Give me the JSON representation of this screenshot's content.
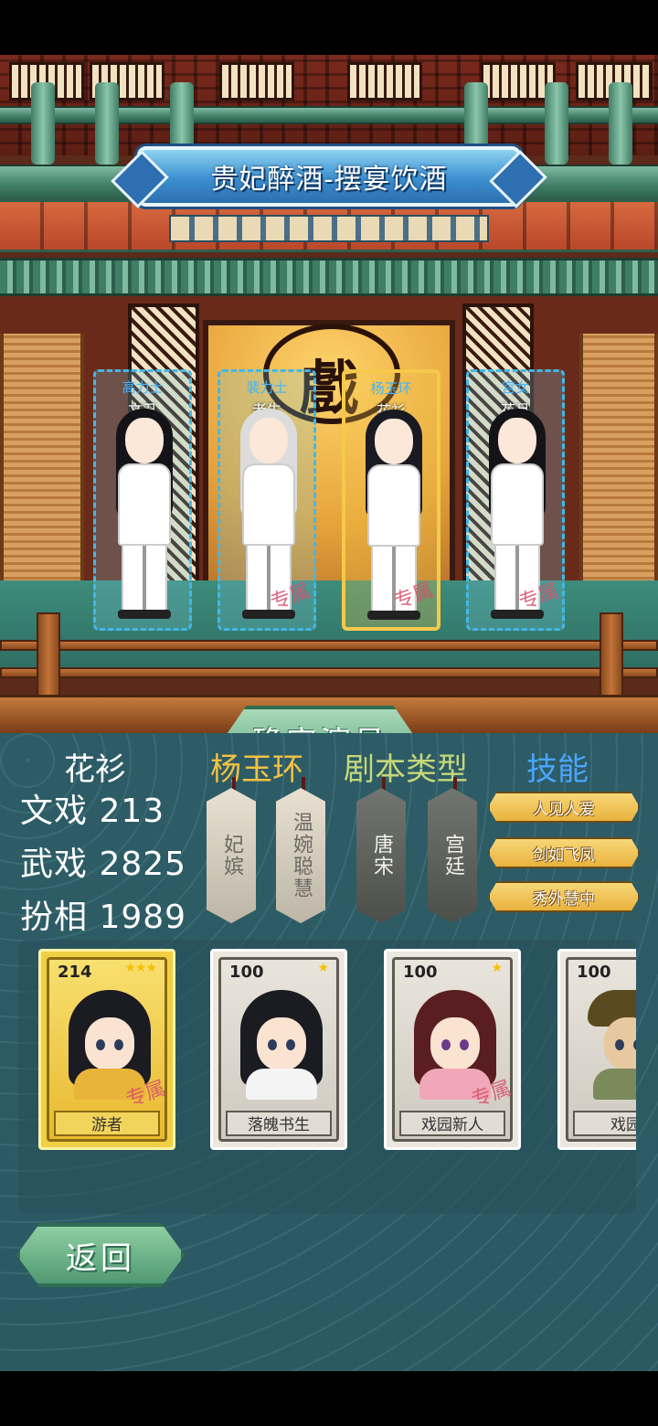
{
  "title": "贵妃醉酒-摆宴饮酒",
  "stage_sign": "戲",
  "exclusive_mark": "专属",
  "slots": [
    {
      "role": "高力士",
      "type": "文丑",
      "selected": false
    },
    {
      "role": "裴力士",
      "type": "老生",
      "selected": false
    },
    {
      "role": "杨玉环",
      "type": "花衫",
      "selected": true
    },
    {
      "role": "宫女",
      "type": "花旦",
      "selected": false
    }
  ],
  "confirm_label": "确定演员",
  "headers": {
    "type": "花衫",
    "character": "杨玉环",
    "genre": "剧本类型",
    "skill": "技能"
  },
  "stats": {
    "wen": "文戏 213",
    "wu": "武戏 2825",
    "ban": "扮相 1989"
  },
  "character_tags": [
    "妃嫔",
    "温婉聪慧"
  ],
  "genre_tags": [
    "唐宋",
    "宫廷"
  ],
  "skills": [
    "人见人爱",
    "剑如飞凤",
    "秀外慧中"
  ],
  "cards": [
    {
      "level": "214",
      "stars": "★★★",
      "name": "游者",
      "exclusive": true
    },
    {
      "level": "100",
      "stars": "★",
      "name": "落魄书生",
      "exclusive": false
    },
    {
      "level": "100",
      "stars": "★",
      "name": "戏园新人",
      "exclusive": true
    },
    {
      "level": "100",
      "stars": "",
      "name": "戏园",
      "exclusive": false
    }
  ],
  "back_label": "返回",
  "colors": {
    "slot_border": "#42b7e8",
    "selected_border": "#f5c94a",
    "character_header": "#f5c143",
    "genre_header": "#c6d87a",
    "skill_header": "#4aa6ff",
    "panel_bg": "#2d5c66"
  }
}
